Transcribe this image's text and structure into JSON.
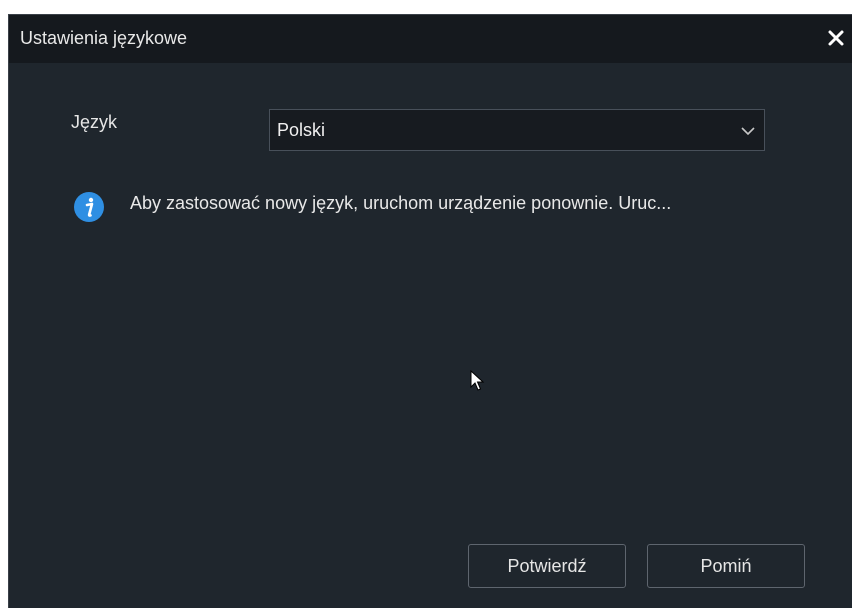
{
  "dialog": {
    "title": "Ustawienia językowe",
    "close_icon": "close-icon"
  },
  "language": {
    "label": "Język",
    "selected": "Polski",
    "dropdown_icon": "chevron-down-icon"
  },
  "notice": {
    "icon": "info-icon",
    "text": "Aby zastosować nowy język, uruchom urządzenie ponownie. Uruc..."
  },
  "buttons": {
    "confirm": "Potwierdź",
    "skip": "Pomiń"
  },
  "colors": {
    "dialog_bg": "#1f262d",
    "titlebar_bg": "#15191e",
    "info_blue": "#2f8fe3",
    "text": "#e8e8e8"
  }
}
